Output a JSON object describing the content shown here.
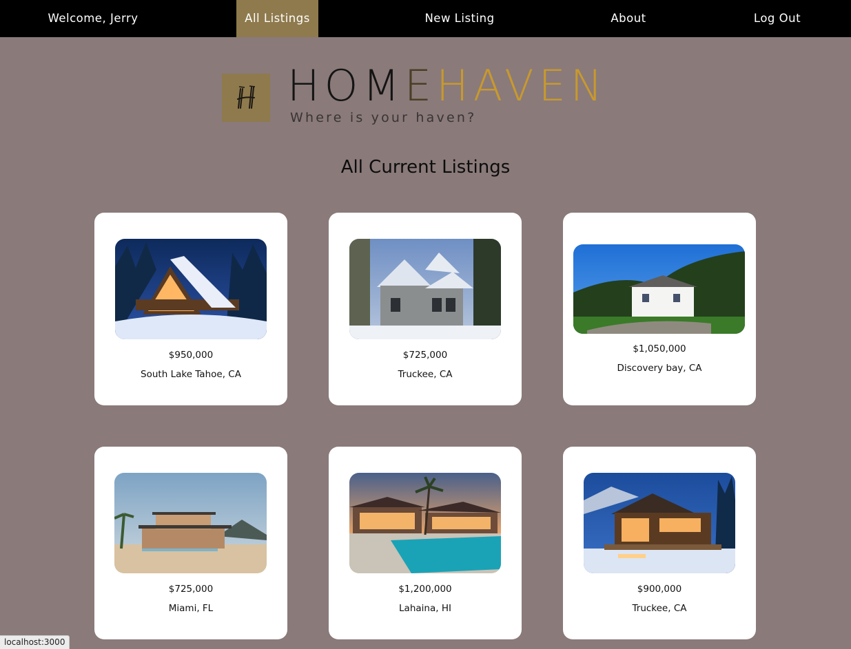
{
  "nav": {
    "welcome": "Welcome, Jerry",
    "all_listings": "All Listings",
    "new_listing": "New Listing",
    "about": "About",
    "log_out": "Log Out",
    "active_color": "#8e7a4c",
    "background": "#000000"
  },
  "brand": {
    "part1": "HOM",
    "part2": "E",
    "part3": "HAVEN",
    "tagline": "Where is your haven?",
    "mark_letter": "H",
    "colors": {
      "dark": "#141414",
      "mid": "#4a3f24",
      "gold": "#c8992e",
      "mark_bg": "#8e7a4c"
    }
  },
  "page": {
    "title": "All Current Listings",
    "background": "#8a7a7a"
  },
  "listings": [
    {
      "price": "$950,000",
      "location": "South Lake Tahoe, CA",
      "image": "snowy-a-frame-cabin-photo"
    },
    {
      "price": "$725,000",
      "location": "Truckee, CA",
      "image": "snowy-victorian-house-photo"
    },
    {
      "price": "$1,050,000",
      "location": "Discovery bay, CA",
      "image": "white-hillside-house-photo"
    },
    {
      "price": "$725,000",
      "location": "Miami, FL",
      "image": "beach-modern-house-photo"
    },
    {
      "price": "$1,200,000",
      "location": "Lahaina, HI",
      "image": "pool-villa-sunset-photo"
    },
    {
      "price": "$900,000",
      "location": "Truckee, CA",
      "image": "lit-mountain-lodge-photo"
    }
  ],
  "status": {
    "url": "localhost:3000"
  }
}
